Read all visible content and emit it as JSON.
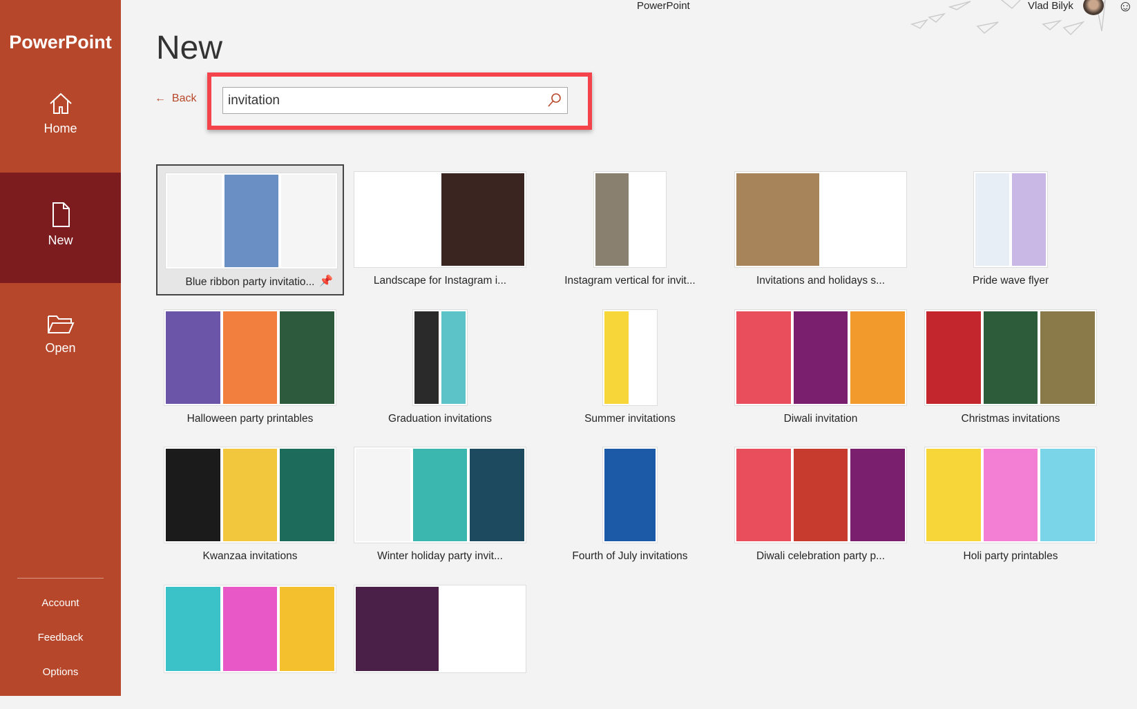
{
  "app_title": "PowerPoint",
  "user": {
    "name": "Vlad Bilyk"
  },
  "sidebar": {
    "brand": "PowerPoint",
    "items": [
      {
        "label": "Home",
        "icon": "home-icon"
      },
      {
        "label": "New",
        "icon": "new-document-icon",
        "active": true
      },
      {
        "label": "Open",
        "icon": "folder-icon"
      }
    ],
    "bottom": [
      "Account",
      "Feedback",
      "Options"
    ]
  },
  "page": {
    "title": "New",
    "back_label": "Back",
    "search_value": "invitation"
  },
  "colors": {
    "accent": "#b7472a",
    "active_nav": "#7d1c1f",
    "highlight": "#f4434a"
  },
  "templates": [
    {
      "label": "Blue ribbon party invitatio...",
      "selected": true,
      "colors": [
        "#f5f5f5",
        "#6a8fc4",
        "#f5f5f5"
      ]
    },
    {
      "label": "Landscape for Instagram i...",
      "colors": [
        "#ffffff",
        "#3a2520"
      ]
    },
    {
      "label": "Instagram vertical for invit...",
      "colors": [
        "#8a8070",
        "#ffffff"
      ]
    },
    {
      "label": "Invitations and holidays s...",
      "colors": [
        "#a8845a",
        "#ffffff"
      ]
    },
    {
      "label": "Pride wave flyer",
      "colors": [
        "#e8eef5",
        "#c9b8e6"
      ]
    },
    {
      "label": "Halloween party printables",
      "colors": [
        "#6b55a8",
        "#f27f3d",
        "#2d5a3d"
      ]
    },
    {
      "label": "Graduation invitations",
      "colors": [
        "#2a2a2a",
        "#5cc4c9"
      ]
    },
    {
      "label": "Summer invitations",
      "colors": [
        "#f7d63a",
        "#ffffff"
      ]
    },
    {
      "label": "Diwali invitation",
      "colors": [
        "#e94e5c",
        "#7a1f6d",
        "#f39a2d"
      ]
    },
    {
      "label": "Christmas invitations",
      "colors": [
        "#c4262e",
        "#2d5c3a",
        "#8a7a4a"
      ]
    },
    {
      "label": "Kwanzaa invitations",
      "colors": [
        "#1b1b1b",
        "#f2c73d",
        "#1d6b5a"
      ]
    },
    {
      "label": "Winter holiday party invit...",
      "colors": [
        "#f5f5f5",
        "#3bb7b0",
        "#1d4a5e"
      ]
    },
    {
      "label": "Fourth of July invitations",
      "colors": [
        "#1c5aa8"
      ]
    },
    {
      "label": "Diwali celebration party p...",
      "colors": [
        "#e94e5c",
        "#c73a2e",
        "#7a1f6d"
      ]
    },
    {
      "label": "Holi party printables",
      "colors": [
        "#f7d63a",
        "#f27fd4",
        "#7ad5e8"
      ]
    },
    {
      "label": "",
      "colors": [
        "#3bc2c9",
        "#e858c7",
        "#f5c02d"
      ]
    },
    {
      "label": "",
      "colors": [
        "#4a1f48",
        "#ffffff"
      ]
    }
  ]
}
